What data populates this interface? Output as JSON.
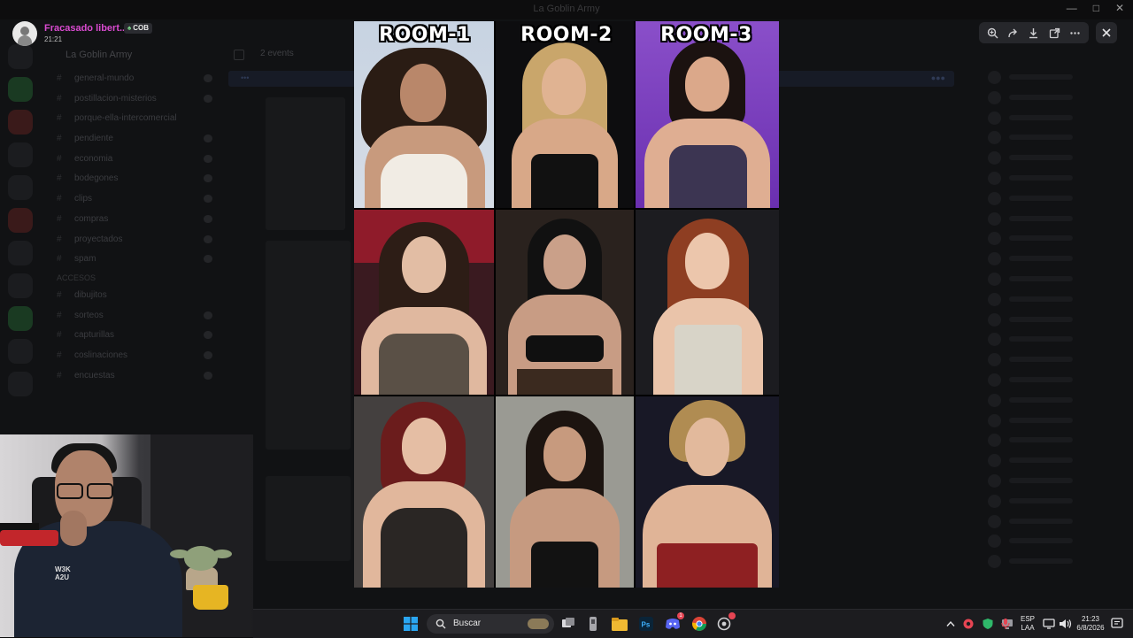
{
  "window": {
    "title": "La Goblin Army"
  },
  "viewer": {
    "username": "Fracasado libert...",
    "badge_tag": "COB",
    "timestamp": "21:21"
  },
  "background_app": {
    "server_name": "La Goblin Army",
    "channel_header": "2 events",
    "channels": [
      "general-mundo",
      "postillacion-misterios",
      "porque-ella-intercomercial",
      "pendiente",
      "economia",
      "bodegones",
      "clips",
      "compras",
      "proyectados",
      "spam"
    ],
    "category": "ACCESOS",
    "channels2": [
      "dibujitos",
      "sorteos",
      "capturillas",
      "coslinaciones",
      "encuestas"
    ]
  },
  "collage": {
    "room_labels": [
      "ROOM-1",
      "ROOM-2",
      "ROOM-3"
    ]
  },
  "taskbar": {
    "search_placeholder": "Buscar",
    "lang_line1": "ESP",
    "lang_line2": "LAA",
    "clock_time": "21:23",
    "clock_date": "6/8/2026",
    "discord_badge": "1"
  }
}
